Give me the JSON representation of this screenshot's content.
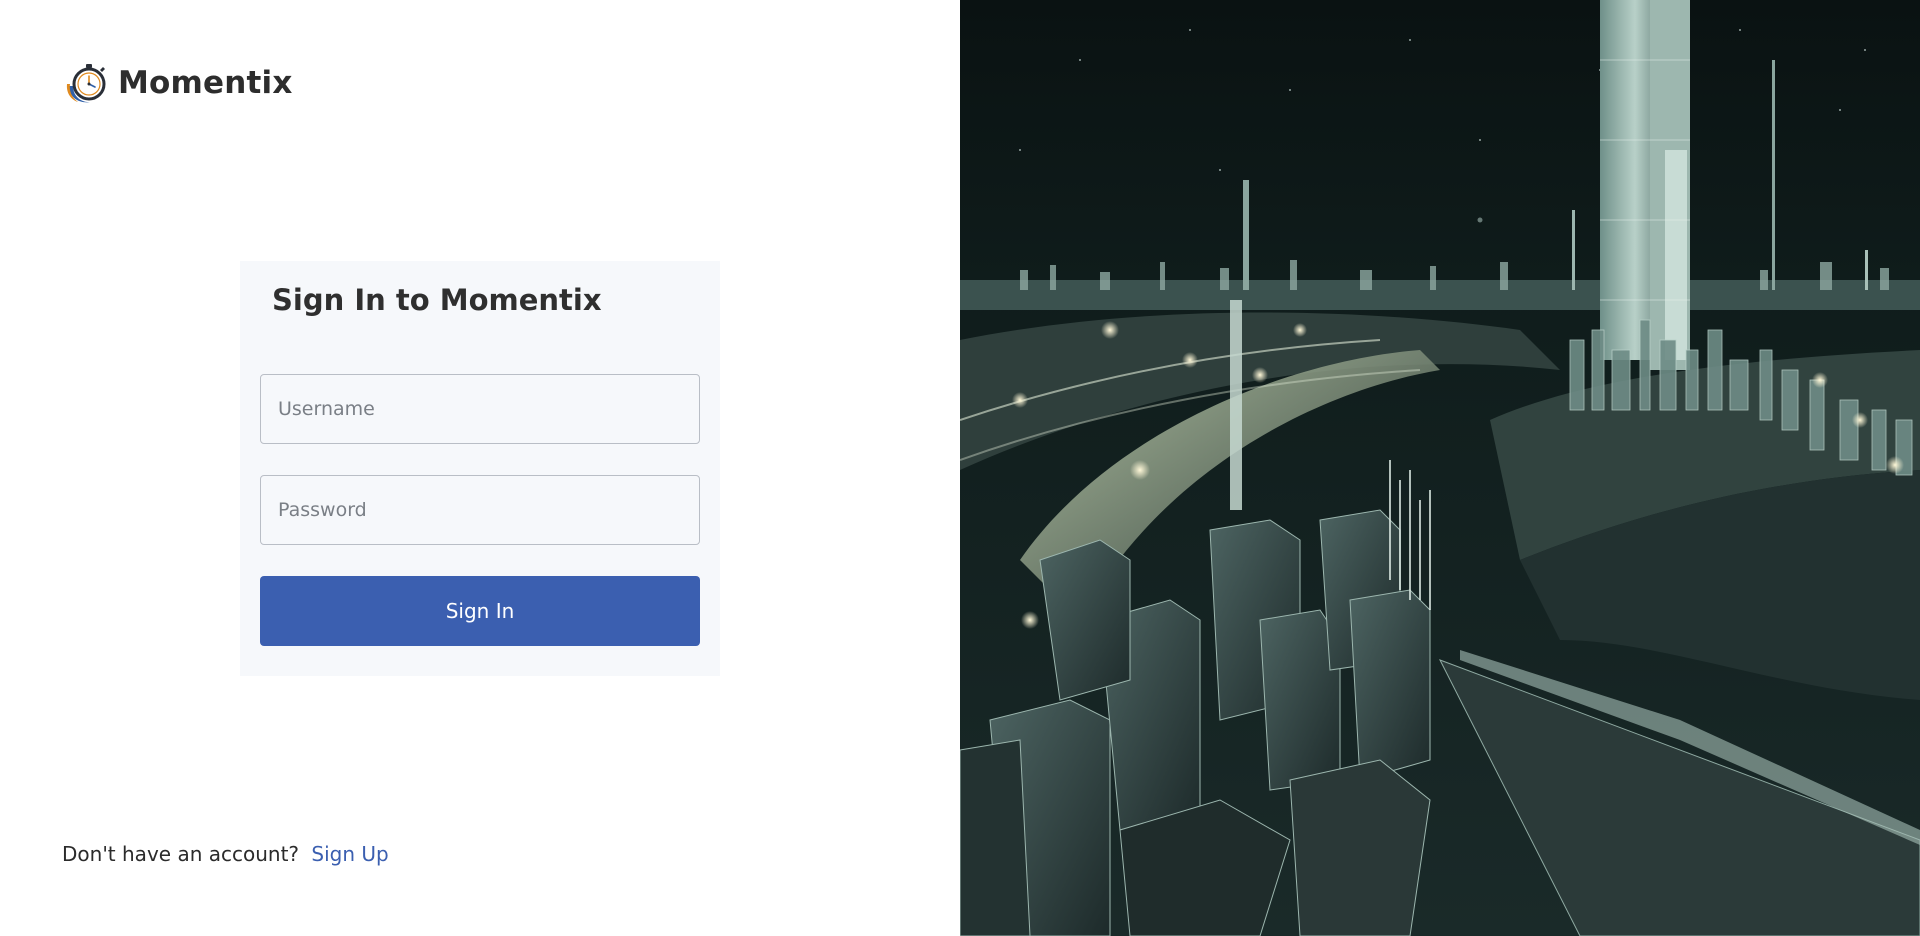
{
  "brand": {
    "name": "Momentix",
    "logo_icon": "stopwatch-icon"
  },
  "login": {
    "title": "Sign In to Momentix",
    "username_placeholder": "Username",
    "password_placeholder": "Password",
    "submit_label": "Sign In"
  },
  "signup": {
    "prompt": "Don't have an account?",
    "link_label": "Sign Up"
  },
  "colors": {
    "accent": "#3b5fb0",
    "card_bg": "#f6f8fb",
    "text": "#2d2d2d"
  },
  "hero_image": {
    "icon": "city-skyline-image"
  }
}
